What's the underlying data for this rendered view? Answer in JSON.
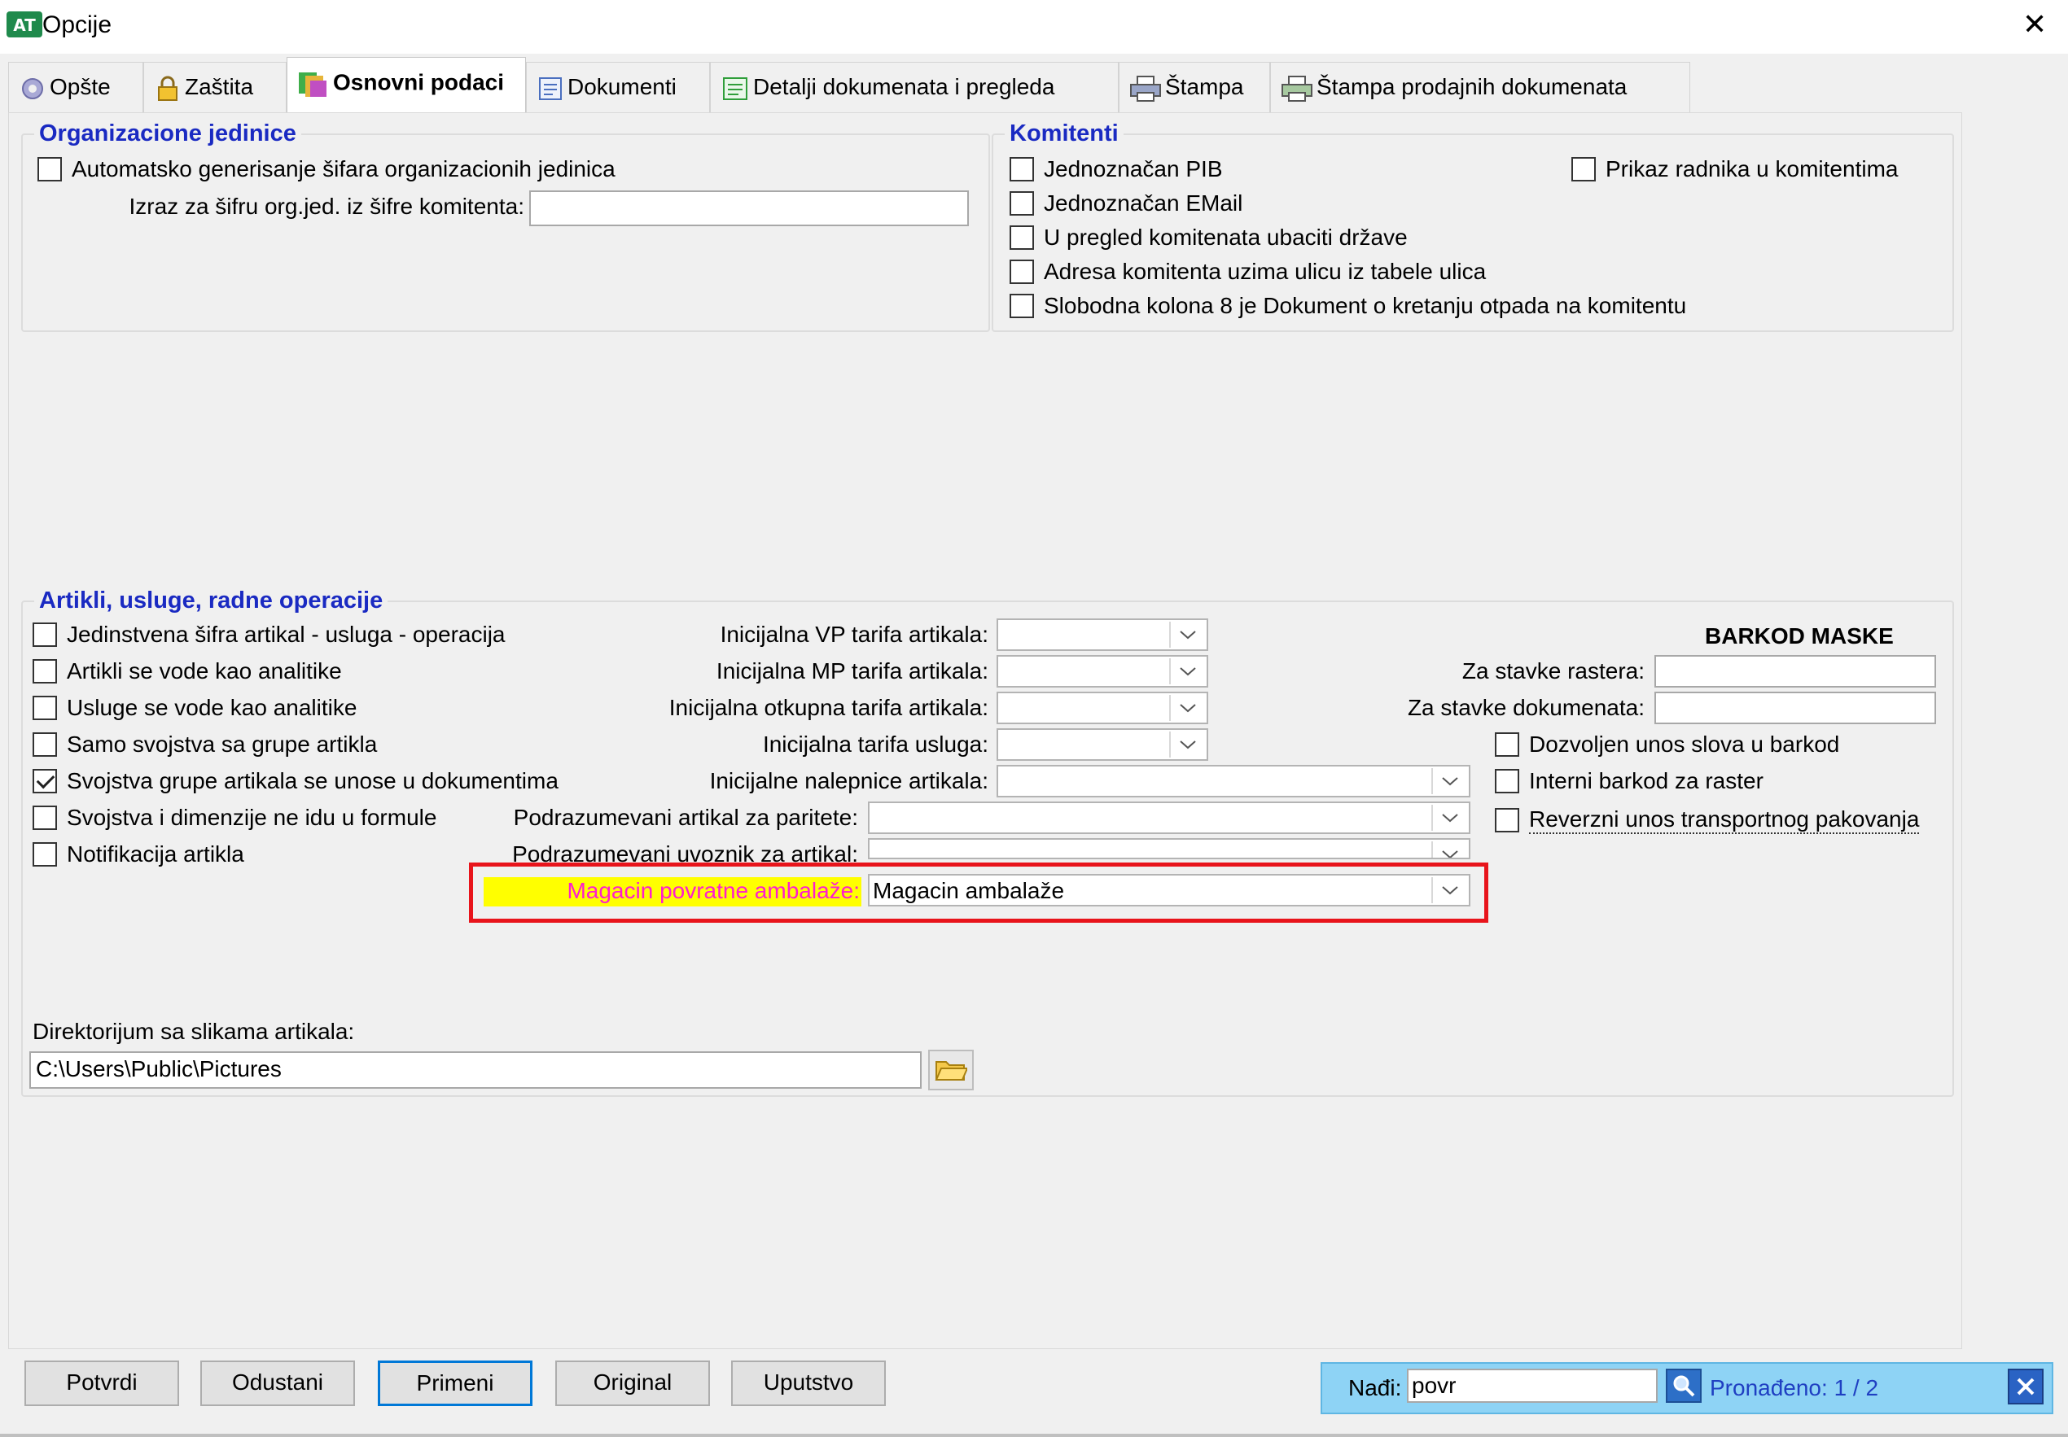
{
  "window": {
    "title": "Opcije",
    "close_label": "✕"
  },
  "tabs": [
    {
      "label": "Opšte"
    },
    {
      "label": "Zaštita"
    },
    {
      "label": "Osnovni podaci"
    },
    {
      "label": "Dokumenti"
    },
    {
      "label": "Detalji dokumenata i pregleda"
    },
    {
      "label": "Štampa"
    },
    {
      "label": "Štampa prodajnih dokumenata"
    }
  ],
  "org": {
    "legend": "Organizacione jedinice",
    "auto_label": "Automatsko generisanje šifara organizacionih jedinica",
    "auto_checked": false,
    "expr_label": "Izraz za šifru org.jed. iz šifre komitenta:",
    "expr_value": ""
  },
  "komitenti": {
    "legend": "Komitenti",
    "items": [
      {
        "label": "Jednoznačan PIB",
        "checked": false
      },
      {
        "label": "Jednoznačan EMail",
        "checked": false
      },
      {
        "label": "U pregled komitenata ubaciti države",
        "checked": false
      },
      {
        "label": "Adresa komitenta uzima ulicu iz tabele ulica",
        "checked": false
      },
      {
        "label": "Slobodna kolona 8 je Dokument o kretanju otpada na komitentu",
        "checked": false
      }
    ],
    "prikaz_label": "Prikaz radnika u komitentima",
    "prikaz_checked": false
  },
  "artikli": {
    "legend": "Artikli, usluge, radne operacije",
    "checks": [
      {
        "label": "Jedinstvena šifra artikal - usluga - operacija",
        "checked": false
      },
      {
        "label": "Artikli se vode kao analitike",
        "checked": false
      },
      {
        "label": "Usluge se vode kao analitike",
        "checked": false
      },
      {
        "label": "Samo svojstva sa grupe artikla",
        "checked": false
      },
      {
        "label": "Svojstva grupe artikala se unose u dokumentima",
        "checked": true
      },
      {
        "label": "Svojstva i dimenzije ne idu u formule",
        "checked": false
      },
      {
        "label": "Notifikacija artikla",
        "checked": false
      }
    ],
    "tarifa": [
      {
        "label": "Inicijalna VP tarifa artikala:",
        "value": ""
      },
      {
        "label": "Inicijalna MP tarifa artikala:",
        "value": ""
      },
      {
        "label": "Inicijalna otkupna tarifa artikala:",
        "value": ""
      },
      {
        "label": "Inicijalna tarifa usluga:",
        "value": ""
      }
    ],
    "wide_combos": [
      {
        "label": "Inicijalne nalepnice artikala:",
        "value": ""
      },
      {
        "label": "Podrazumevani artikal za paritete:",
        "value": ""
      },
      {
        "label": "Podrazumevani uvoznik za artikal:",
        "value": ""
      }
    ],
    "magacin": {
      "label": "Magacin povratne ambalaže:",
      "value": "Magacin ambalaže"
    },
    "barkod": {
      "title": "BARKOD MASKE",
      "rastera_label": "Za stavke rastera:",
      "rastera_value": "",
      "dokumenata_label": "Za stavke dokumenata:",
      "dokumenata_value": "",
      "checks": [
        {
          "label": "Dozvoljen unos slova u barkod",
          "checked": false
        },
        {
          "label": "Interni barkod za raster",
          "checked": false
        },
        {
          "label": "Reverzni unos transportnog pakovanja",
          "checked": false
        }
      ]
    },
    "dir_label": "Direktorijum sa slikama artikala:",
    "dir_value": "C:\\Users\\Public\\Pictures"
  },
  "buttons": {
    "potvrdi": "Potvrdi",
    "odustani": "Odustani",
    "primeni": "Primeni",
    "original": "Original",
    "uputstvo": "Uputstvo"
  },
  "find": {
    "label": "Nađi:",
    "value": "povr",
    "result": "Pronađeno: 1 / 2"
  },
  "colors": {
    "legend": "#1a2ac2",
    "highlight": "#ffff00",
    "magenta": "#ff1dce",
    "red_box": "#e8141b",
    "find_bg": "#8ed3f5"
  }
}
